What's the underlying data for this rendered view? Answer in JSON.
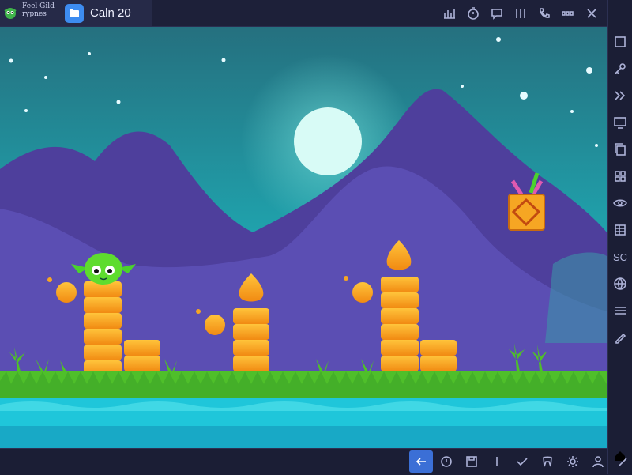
{
  "app": {
    "name_line1": "Feel Gild",
    "name_line2": "rypnes",
    "tab_title": "Caln 20"
  },
  "toolbar_icons": [
    "bar-chart-icon",
    "timer-icon",
    "chat-icon",
    "columns-icon",
    "phone-icon",
    "more-icon",
    "close-icon"
  ],
  "sidebar_icons": [
    "square-icon",
    "key-icon",
    "forward-icon",
    "monitor-icon",
    "copy-icon",
    "grid-icon",
    "eye-icon",
    "table-icon",
    "sc-icon",
    "globe-icon",
    "layers-icon",
    "pen-icon"
  ],
  "sidebar_sc_label": "SC",
  "sidebar_bottom_icons": [
    "plus-icon",
    "home-icon"
  ],
  "bottom_icons": [
    "back-arrow-icon",
    "clock-icon",
    "save-icon",
    "slash-icon",
    "check-icon",
    "tooth-icon",
    "gear-icon",
    "person-icon",
    "pencil-icon"
  ],
  "colors": {
    "sky_top": "#2a8f9e",
    "sky_bottom": "#1fc0c4",
    "mountain": "#4a3d9a",
    "mountain_light": "#5b4fb0",
    "grass": "#4fbf2a",
    "water": "#20c8dc",
    "coin": "#f6a623",
    "accent_blue": "#3b6fd6"
  }
}
